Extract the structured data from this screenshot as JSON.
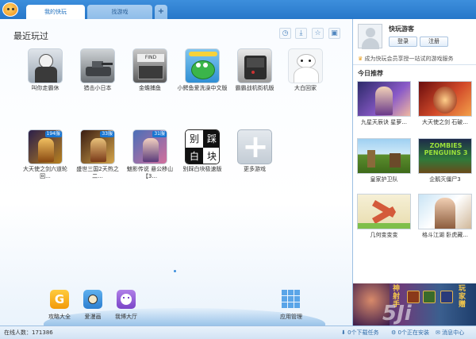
{
  "tabs": {
    "my": "我的快玩",
    "find": "找游戏",
    "add": "+"
  },
  "section_title": "最近玩过",
  "toolbar_icons": [
    "clock-icon",
    "download-icon",
    "star-icon",
    "trash-icon"
  ],
  "games": [
    {
      "name": "叫你走霸休",
      "icon": "cartoon-character-icon"
    },
    {
      "name": "猎击小日本",
      "icon": "tank-icon"
    },
    {
      "name": "金蟾捕鱼",
      "icon": "fish-store-icon"
    },
    {
      "name": "小鳄鱼爱洗澡中文版",
      "icon": "crocodile-icon"
    },
    {
      "name": "霸霸战机街机版",
      "icon": "arcade-machine-icon"
    },
    {
      "name": "大白回家",
      "icon": "white-robot-icon"
    },
    {
      "name": "大天使之剑六道轮回...",
      "icon": "warrior-icon",
      "badge": "194服"
    },
    {
      "name": "盛世三国2天热之二...",
      "icon": "warrior-icon",
      "badge": "33服"
    },
    {
      "name": "魅影传说 悬公移山【3...",
      "icon": "warrior-icon",
      "badge": "31服"
    },
    {
      "name": "别踩白块极速版",
      "icon": "piano-tiles-icon",
      "tiles": [
        "别",
        "踩",
        "白",
        "块"
      ]
    },
    {
      "name": "更多游戏",
      "icon": "plus-icon",
      "glyph": "+"
    }
  ],
  "dock": [
    {
      "label": "攻略大全",
      "icon": "guide-icon",
      "glyph": "G"
    },
    {
      "label": "爱漫画",
      "icon": "comic-icon"
    },
    {
      "label": "我博大厅",
      "icon": "lobby-icon"
    },
    {
      "label": "应用管理",
      "icon": "app-grid-icon"
    }
  ],
  "side": {
    "username": "快玩游客",
    "login": "登录",
    "register": "注册",
    "promo": "成为快玩会员享授一站试的游戏服务",
    "today_title": "今日推荐",
    "recommended": [
      {
        "name": "九星天辰诀  星萝...",
        "icon": "fantasy-warrior-icon"
      },
      {
        "name": "大天使之剑  石破...",
        "icon": "dragon-icon"
      },
      {
        "name": "皇家护卫队",
        "icon": "tower-defense-icon"
      },
      {
        "name": "企鹅灭僵尸3",
        "icon": "zombie-penguin-icon",
        "text": "ZOMBIES PENGUINS 3"
      },
      {
        "name": "几何变变变",
        "icon": "geometry-icon"
      },
      {
        "name": "格斗江湖  卧虎藏...",
        "icon": "fighter-icon"
      }
    ],
    "banner": {
      "title_left": "神射手",
      "title_right": "玩家赠"
    }
  },
  "status": {
    "online_label": "在线人数：171386",
    "downloads": "0个下载任务",
    "speed": "0个正在安装",
    "msg": "消息中心"
  },
  "watermark": "5Ji"
}
